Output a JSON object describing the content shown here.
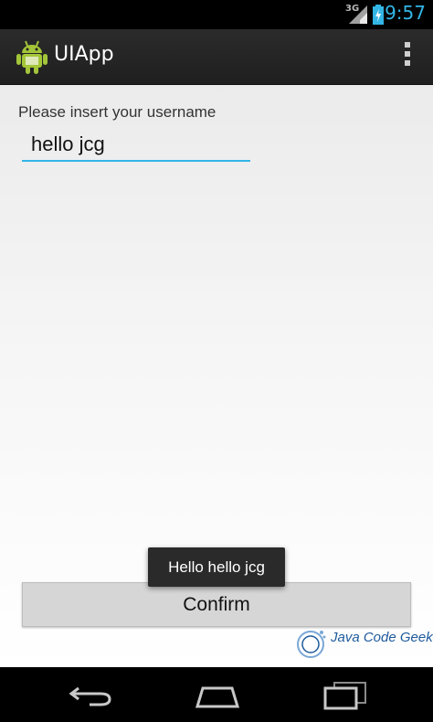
{
  "status_bar": {
    "network": "3G",
    "time": "9:57"
  },
  "action_bar": {
    "title": "UIApp",
    "icons": [
      "android-icon",
      "overflow-menu-icon"
    ]
  },
  "form": {
    "prompt": "Please insert your username",
    "username_value": "hello jcg",
    "confirm_label": "Confirm"
  },
  "toast": {
    "message": "Hello hello jcg"
  },
  "watermark": {
    "text": "Java Code Geeks"
  },
  "nav_bar": {
    "icons": [
      "back-icon",
      "home-icon",
      "recent-apps-icon"
    ]
  },
  "colors": {
    "accent": "#33b5e5",
    "action_bar": "#232323",
    "android_green": "#a4c639"
  }
}
